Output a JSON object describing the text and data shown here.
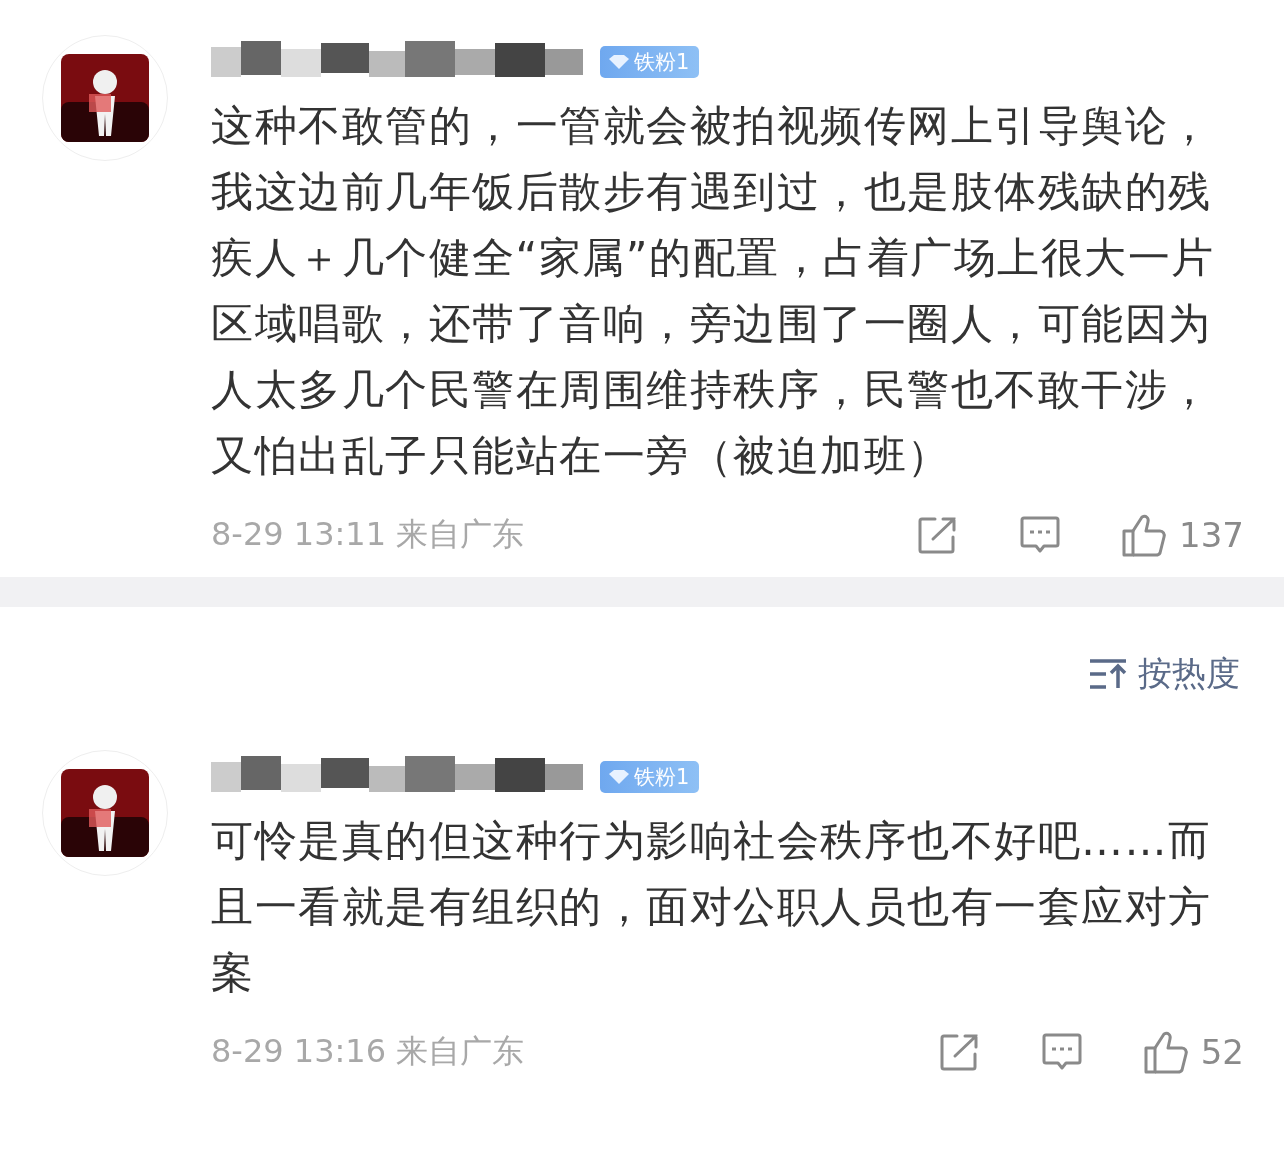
{
  "top_comment": {
    "badge": "铁粉1",
    "text": "这种不敢管的，一管就会被拍视频传网上引导舆论，我这边前几年饭后散步有遇到过，也是肢体残缺的残疾人＋几个健全“家属”的配置，占着广场上很大一片区域唱歌，还带了音响，旁边围了一圈人，可能因为人太多几个民警在周围维持秩序，民警也不敢干涉，又怕出乱子只能站在一旁（被迫加班）",
    "time": "8-29 13:11",
    "location": "来自广东",
    "likes": "137"
  },
  "sort": {
    "label": "按热度"
  },
  "comments": [
    {
      "badge": "铁粉1",
      "text": "可怜是真的但这种行为影响社会秩序也不好吧……而且一看就是有组织的，面对公职人员也有一套应对方案",
      "time": "8-29 13:16",
      "location": "来自广东",
      "likes": "52"
    }
  ]
}
